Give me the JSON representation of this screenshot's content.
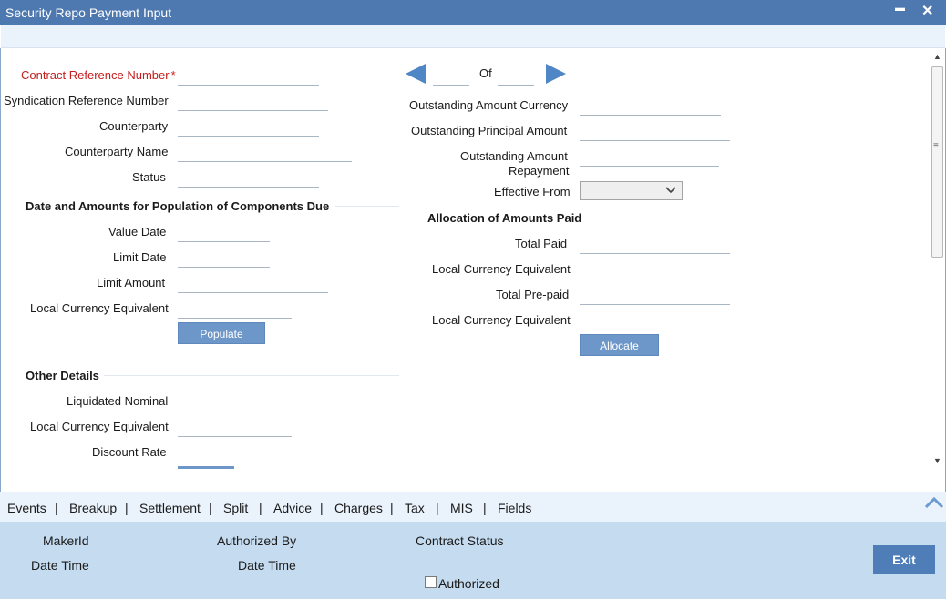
{
  "window": {
    "title": "Security Repo Payment Input",
    "minimize": "▬",
    "close": "✕"
  },
  "left": {
    "contract_ref": "Contract Reference Number",
    "required_mark": "*",
    "syndication_ref": "Syndication Reference Number",
    "counterparty": "Counterparty",
    "counterparty_name": "Counterparty Name",
    "status": "Status",
    "section_dates": "Date and Amounts for Population of Components Due",
    "value_date": "Value Date",
    "limit_date": "Limit Date",
    "limit_amount": "Limit Amount",
    "lce1": "Local Currency Equivalent",
    "populate": "Populate",
    "section_other": "Other Details",
    "liquidated_nominal": "Liquidated Nominal",
    "lce2": "Local Currency Equivalent",
    "discount_rate": "Discount Rate"
  },
  "right": {
    "of": "Of",
    "outstanding_currency": "Outstanding Amount Currency",
    "outstanding_principal": "Outstanding Principal Amount",
    "outstanding_repayment_1": "Outstanding Amount",
    "outstanding_repayment_2": "Repayment",
    "effective_from": "Effective From",
    "section_alloc": "Allocation of Amounts Paid",
    "total_paid": "Total Paid",
    "lce1": "Local Currency Equivalent",
    "total_prepaid": "Total Pre-paid",
    "lce2": "Local Currency Equivalent",
    "allocate": "Allocate"
  },
  "tabs": [
    "Events",
    "Breakup",
    "Settlement",
    "Split",
    "Advice",
    "Charges",
    "Tax",
    "MIS",
    "Fields"
  ],
  "footer": {
    "maker_id": "MakerId",
    "date_time1": "Date Time",
    "authorized_by": "Authorized By",
    "date_time2": "Date Time",
    "contract_status": "Contract Status",
    "authorized": "Authorized",
    "exit": "Exit"
  },
  "colors": {
    "titlebar": "#4e79b0",
    "accent": "#4e86c6",
    "footer": "#c5dcf0"
  }
}
